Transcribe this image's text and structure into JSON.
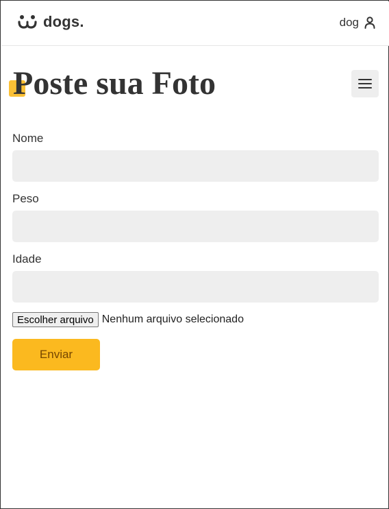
{
  "header": {
    "logo_text": "dogs.",
    "user_name": "dog",
    "logo_icon": "dog-face-icon",
    "user_icon": "user-icon"
  },
  "page": {
    "title": "Poste sua Foto",
    "menu_icon": "hamburger-menu-icon"
  },
  "form": {
    "fields": [
      {
        "label": "Nome",
        "value": ""
      },
      {
        "label": "Peso",
        "value": ""
      },
      {
        "label": "Idade",
        "value": ""
      }
    ],
    "file_button_label": "Escolher arquivo",
    "file_status": "Nenhum arquivo selecionado",
    "submit_label": "Enviar"
  },
  "colors": {
    "accent": "#fbb91f",
    "accent_text": "#764701",
    "input_bg": "#eeeeee",
    "text": "#333333"
  }
}
